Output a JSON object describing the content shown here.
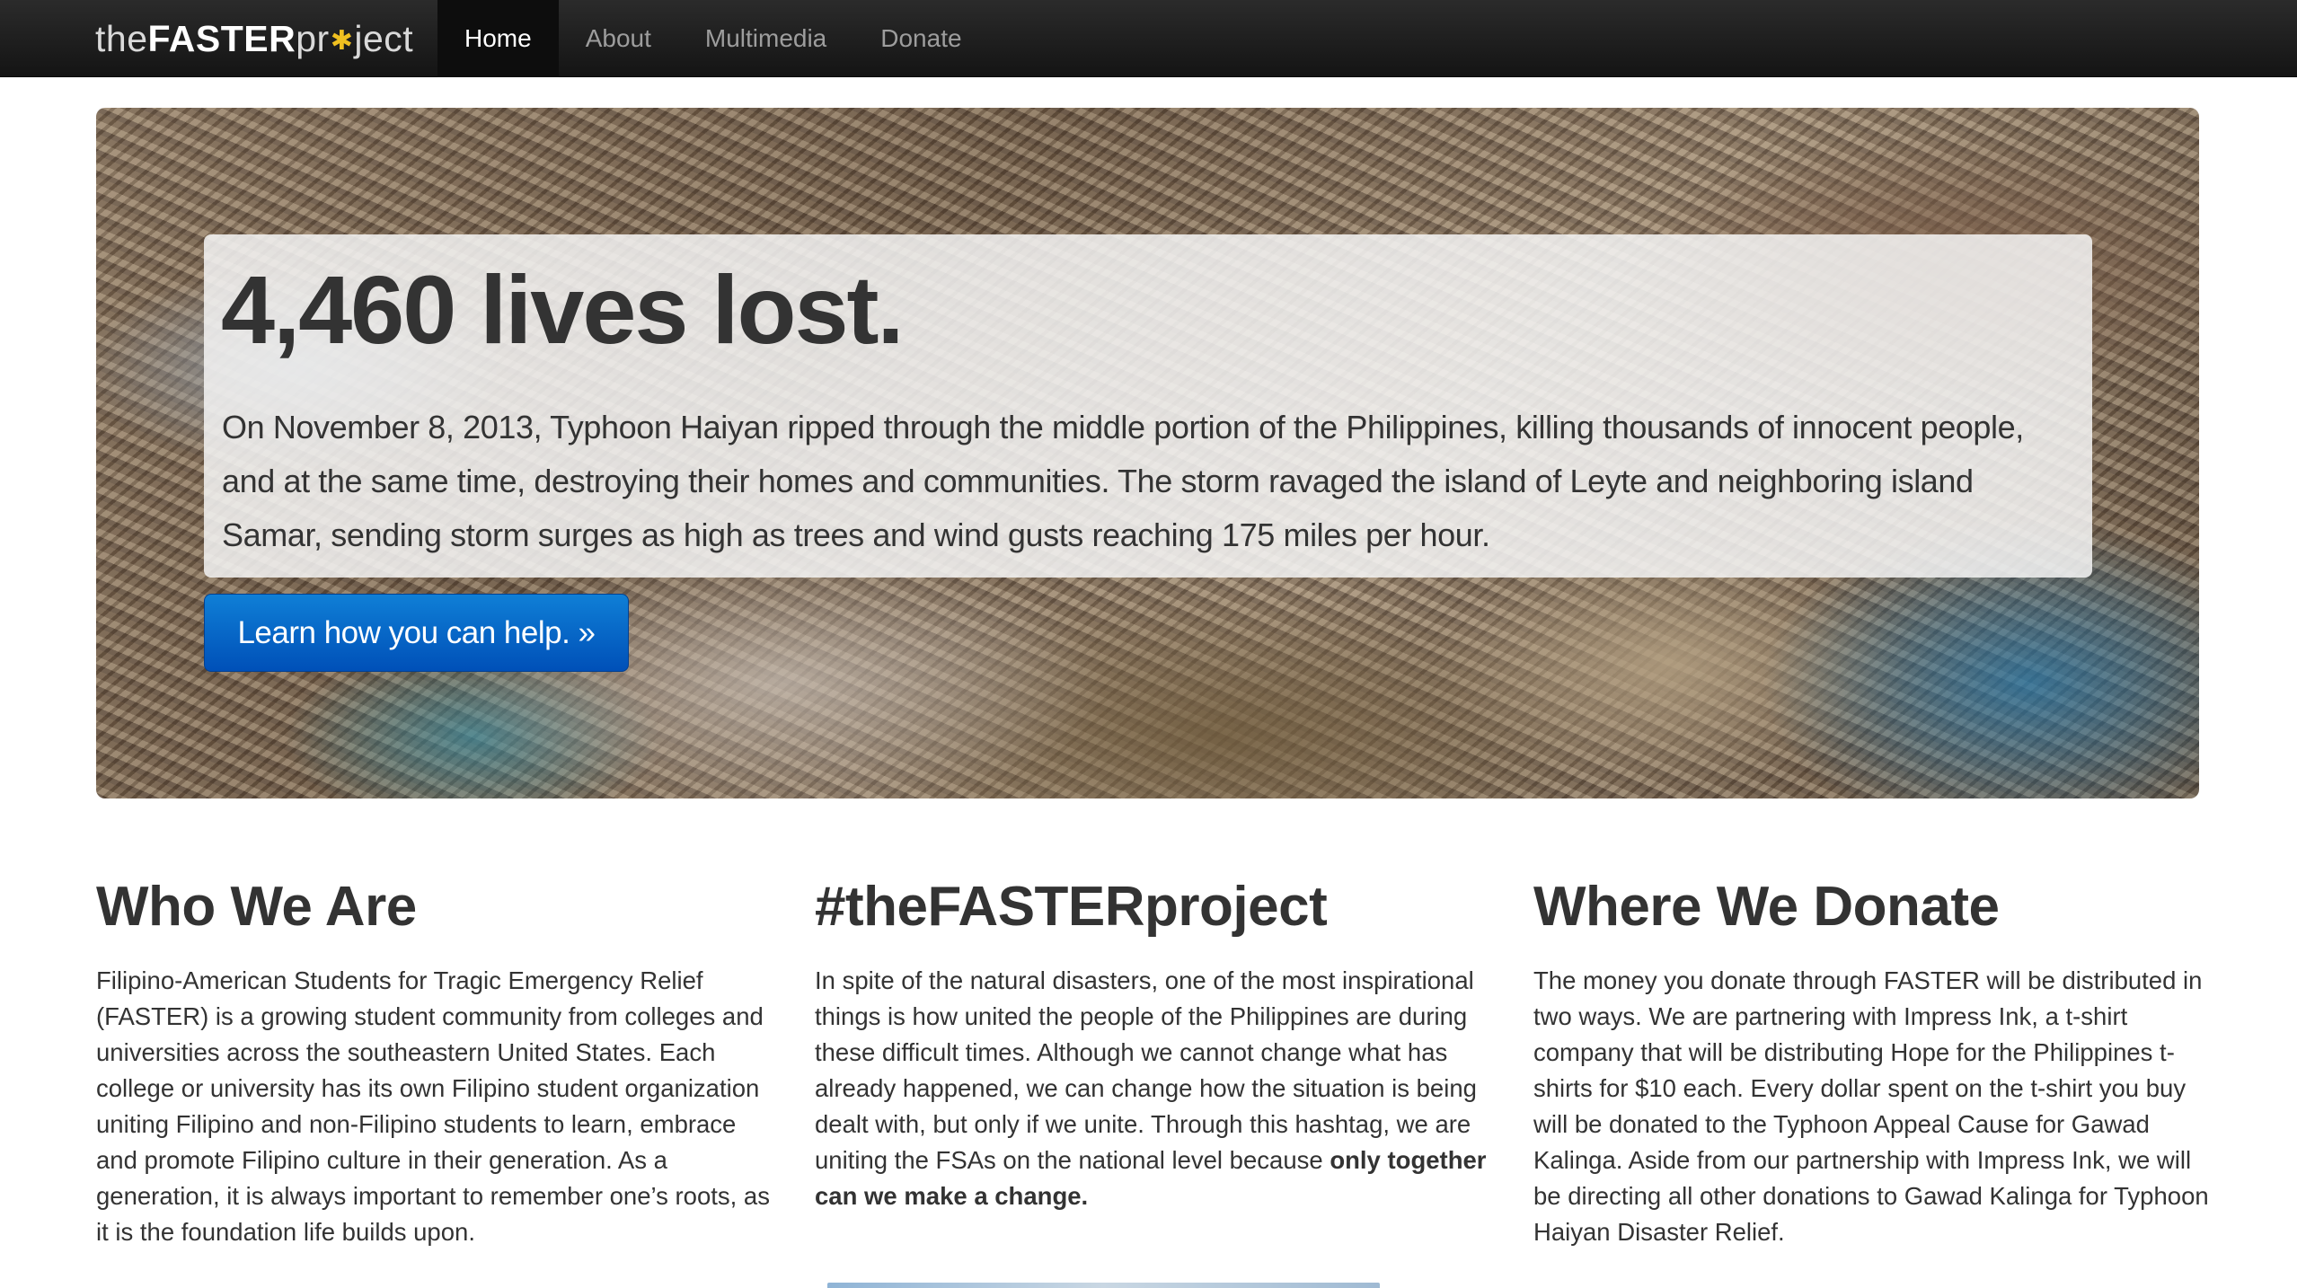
{
  "brand": {
    "the": "the",
    "faster": "FASTER",
    "proj_start": "pr",
    "star_glyph": "✱",
    "proj_end": "ject",
    "star_color": "#f0c020"
  },
  "nav": {
    "items": [
      "Home",
      "About",
      "Multimedia",
      "Donate"
    ],
    "active": "Home"
  },
  "hero": {
    "title": "4,460 lives lost.",
    "text": "On November 8, 2013, Typhoon Haiyan ripped through the middle portion of the Philippines, killing thousands of innocent people, and at the same time, destroying their homes and communities. The storm ravaged the island of Leyte and neighboring island Samar, sending storm surges as high as trees and wind gusts reaching 175 miles per hour.",
    "button_label": "Learn how you can help. »",
    "button_color": "#0a6fd1"
  },
  "columns": {
    "who": {
      "heading": "Who We Are",
      "body": "Filipino-American Students for Tragic Emergency Relief (FASTER) is a growing student community from colleges and universities across the southeastern United States. Each college or university has its own Filipino student organization uniting Filipino and non-Filipino students to learn, embrace and promote Filipino culture in their generation. As a generation, it is always important to remember one’s roots, as it is the foundation life builds upon."
    },
    "project": {
      "heading": "#theFASTERproject",
      "body": "In spite of the natural disasters, one of the most inspirational things is how united the people of the Philippines are during these difficult times. Although we cannot change what has already happened, we can change how the situation is being dealt with, but only if we unite. Through this hashtag, we are uniting the FSAs on the national level because ",
      "body_bold": "only together can we make a change."
    },
    "donate": {
      "heading": "Where We Donate",
      "body": "The money you donate through FASTER will be distributed in two ways. We are partnering with Impress Ink, a t-shirt company that will be distributing Hope for the Philippines t-shirts for $10 each. Every dollar spent on the t-shirt you buy will be donated to the Typhoon Appeal Cause for Gawad Kalinga. Aside from our partnership with Impress Ink, we will be directing all other donations to Gawad Kalinga for Typhoon Haiyan Disaster Relief."
    }
  }
}
